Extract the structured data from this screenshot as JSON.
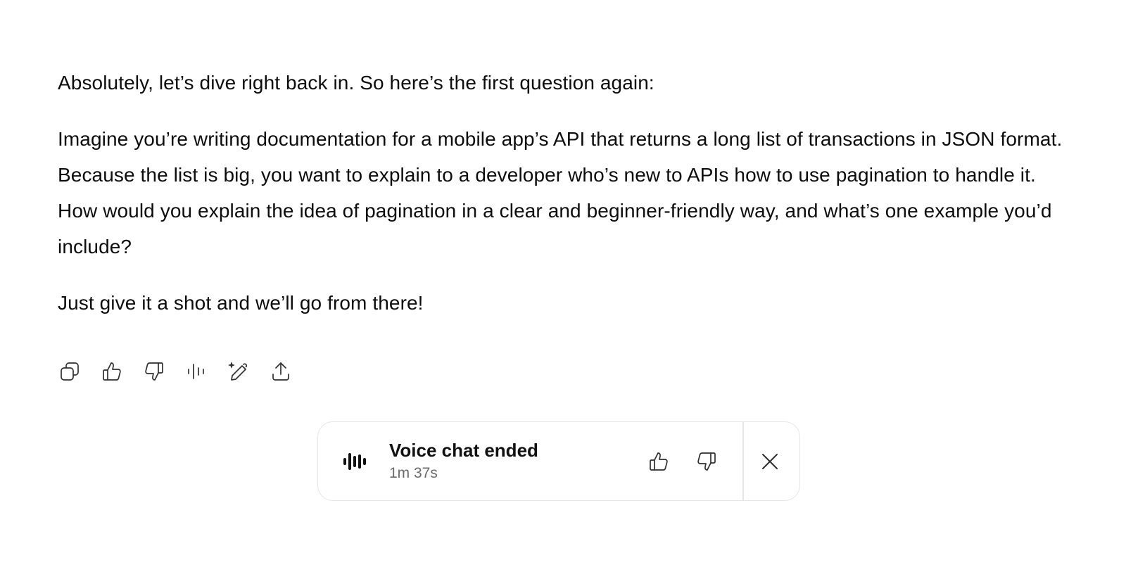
{
  "message": {
    "paragraphs": [
      "Absolutely, let’s dive right back in. So here’s the first question again:",
      "Imagine you’re writing documentation for a mobile app’s API that returns a long list of transactions in JSON format. Because the list is big, you want to explain to a developer who’s new to APIs how to use pagination to handle it. How would you explain the idea of pagination in a clear and beginner-friendly way, and what’s one example you’d include?",
      "Just give it a shot and we’ll go from there!"
    ]
  },
  "actions": [
    {
      "icon": "copy-icon"
    },
    {
      "icon": "thumbs-up-icon"
    },
    {
      "icon": "thumbs-down-icon"
    },
    {
      "icon": "read-aloud-icon"
    },
    {
      "icon": "edit-sparkle-icon"
    },
    {
      "icon": "share-icon"
    }
  ],
  "voice_chat": {
    "title": "Voice chat ended",
    "duration": "1m 37s",
    "icon": "voice-waveform-icon"
  },
  "colors": {
    "text": "#0d0d0d",
    "muted": "#6b6b6b",
    "border": "#e6e6e6",
    "icon": "#2f2f2f"
  }
}
